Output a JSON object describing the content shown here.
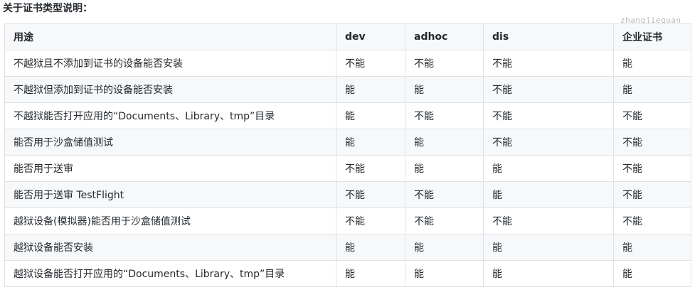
{
  "heading": "关于证书类型说明：",
  "watermark": "zhangjiequan",
  "table": {
    "headers": [
      "用途",
      "dev",
      "adhoc",
      "dis",
      "企业证书"
    ],
    "rows": [
      [
        "不越狱且不添加到证书的设备能否安装",
        "不能",
        "不能",
        "不能",
        "能"
      ],
      [
        "不越狱但添加到证书的设备能否安装",
        "能",
        "能",
        "不能",
        "能"
      ],
      [
        "不越狱能否打开应用的“Documents、Library、tmp”目录",
        "能",
        "不能",
        "不能",
        "不能"
      ],
      [
        "能否用于沙盒储值测试",
        "能",
        "能",
        "不能",
        "不能"
      ],
      [
        "能否用于送审",
        "不能",
        "能",
        "能",
        "不能"
      ],
      [
        "能否用于送审 TestFlight",
        "不能",
        "不能",
        "能",
        "不能"
      ],
      [
        "越狱设备(模拟器)能否用于沙盒储值测试",
        "不能",
        "不能",
        "不能",
        "不能"
      ],
      [
        "越狱设备能否安装",
        "能",
        "能",
        "能",
        "能"
      ],
      [
        "越狱设备能否打开应用的“Documents、Library、tmp”目录",
        "能",
        "能",
        "能",
        "能"
      ]
    ]
  }
}
